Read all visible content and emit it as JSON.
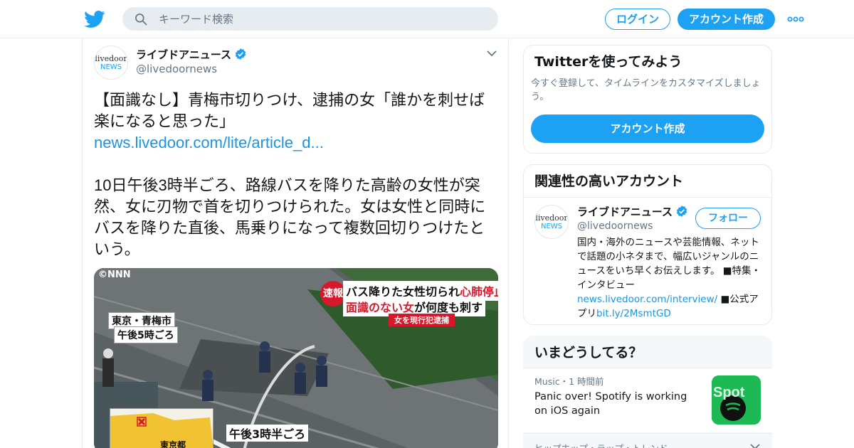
{
  "search": {
    "placeholder": "キーワード検索"
  },
  "header": {
    "login_label": "ログイン",
    "signup_label": "アカウント作成"
  },
  "tweet": {
    "avatar_text_1": "livedoor",
    "avatar_text_2": "NEWS",
    "author_name": "ライブドアニュース",
    "author_handle": "@livedoornews",
    "text_1": "【面識なし】青梅市切りつけ、逮捕の女「誰かを刺せば楽になると思った」",
    "link": "news.livedoor.com/lite/article_d...",
    "text_2": "10日午後3時半ごろ、路線バスを降りた高齢の女性が突然、女に刃物で首を切りつけられた。女は女性と同時にバスを降りた直後、馬乗りになって複数回切りつけたという。",
    "media": {
      "watermark": "©NNN",
      "place_1": "東京・青梅市",
      "place_2": "午後5時ごろ",
      "flash": "速報",
      "headline_1a": "バス降りた女性切られ",
      "headline_1b": "心肺停止",
      "headline_2a": "面識のない女",
      "headline_2b": "が何度も刺す",
      "headline_3": "女を現行犯逮捕",
      "map_label": "東京都",
      "time_label": "午後3時半ごろ"
    }
  },
  "sidebar": {
    "try_card": {
      "title": "Twitterを使ってみよう",
      "subtitle": "今すぐ登録して、タイムラインをカスタマイズしましょう。",
      "cta": "アカウント作成"
    },
    "related_card": {
      "title": "関連性の高いアカウント",
      "avatar_text_1": "livedoor",
      "avatar_text_2": "NEWS",
      "name": "ライブドアニュース",
      "handle": "@livedoornews",
      "follow_label": "フォロー",
      "bio_1": "国内・海外のニュースや芸能情報、ネットで話題の小ネタまで、幅広いジャンルのニュースをいち早くお伝えします。 ■特集・インタビュー",
      "bio_link_1": "news.livedoor.com/interview/",
      "bio_2": " ■公式アプリ",
      "bio_link_2": "bit.ly/2MsmtGD"
    },
    "trends_card": {
      "title": "いまどうしてる？",
      "trend_1": {
        "meta": "Music・1 時間前",
        "title": "Panic over! Spotify is working on iOS again",
        "thumb_text": "Spot"
      },
      "trend_2": {
        "meta": "ヒップホップ・ラップ・トレンド"
      }
    }
  },
  "colors": {
    "accent": "#1da1f2",
    "link": "#1b95e0",
    "verified": "#1da1f2",
    "breaking_red": "#d7182a",
    "spotify_green": "#1db954"
  },
  "icons": [
    "twitter-bird-icon",
    "search-icon",
    "more-dots-icon",
    "verified-badge-icon",
    "chevron-down-icon"
  ]
}
